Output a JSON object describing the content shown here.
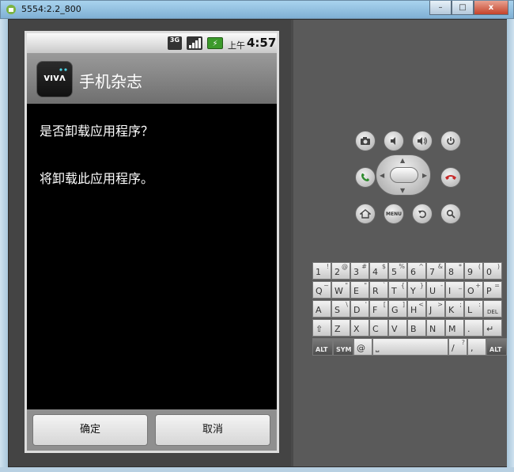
{
  "window": {
    "title": "5554:2.2_800",
    "buttons": [
      "–",
      "□",
      "x"
    ]
  },
  "status": {
    "network": "3G",
    "ampm": "上午",
    "time": "4:57"
  },
  "app": {
    "icon_text": "vıvʌ",
    "title": "手机杂志"
  },
  "dialog": {
    "question": "是否卸载应用程序？",
    "message": "将卸载此应用程序。",
    "ok_label": "确定",
    "cancel_label": "取消"
  },
  "controls": {
    "menu_label": "MENU"
  },
  "keyboard": {
    "rows": [
      [
        [
          "1",
          "!"
        ],
        [
          "2",
          "@"
        ],
        [
          "3",
          "#"
        ],
        [
          "4",
          "$"
        ],
        [
          "5",
          "%"
        ],
        [
          "6",
          "^"
        ],
        [
          "7",
          "&"
        ],
        [
          "8",
          "*"
        ],
        [
          "9",
          "("
        ],
        [
          "0",
          ")"
        ]
      ],
      [
        [
          "Q",
          "~"
        ],
        [
          "W",
          "\""
        ],
        [
          "E",
          "\""
        ],
        [
          "R",
          "`"
        ],
        [
          "T",
          "{"
        ],
        [
          "Y",
          "}"
        ],
        [
          "U",
          "-"
        ],
        [
          "I",
          "_"
        ],
        [
          "O",
          "+"
        ],
        [
          "P",
          "="
        ]
      ],
      [
        [
          "A",
          ""
        ],
        [
          "S",
          "\\"
        ],
        [
          "D",
          "'"
        ],
        [
          "F",
          "["
        ],
        [
          "G",
          "]"
        ],
        [
          "H",
          "<"
        ],
        [
          "J",
          ">"
        ],
        [
          "K",
          ";"
        ],
        [
          "L",
          ":"
        ],
        [
          "DEL",
          ""
        ]
      ],
      [
        [
          "⇧",
          ""
        ],
        [
          "Z",
          ""
        ],
        [
          "X",
          ""
        ],
        [
          "C",
          ""
        ],
        [
          "V",
          ""
        ],
        [
          "B",
          ""
        ],
        [
          "N",
          ""
        ],
        [
          "M",
          ""
        ],
        [
          ".",
          ""
        ],
        [
          "↵",
          ""
        ]
      ],
      [
        [
          "ALT",
          ""
        ],
        [
          "SYM",
          ""
        ],
        [
          "@",
          ""
        ],
        [
          "⎵",
          ""
        ],
        [
          "/",
          "?"
        ],
        [
          ",",
          ""
        ],
        [
          "ALT",
          ""
        ]
      ]
    ]
  }
}
